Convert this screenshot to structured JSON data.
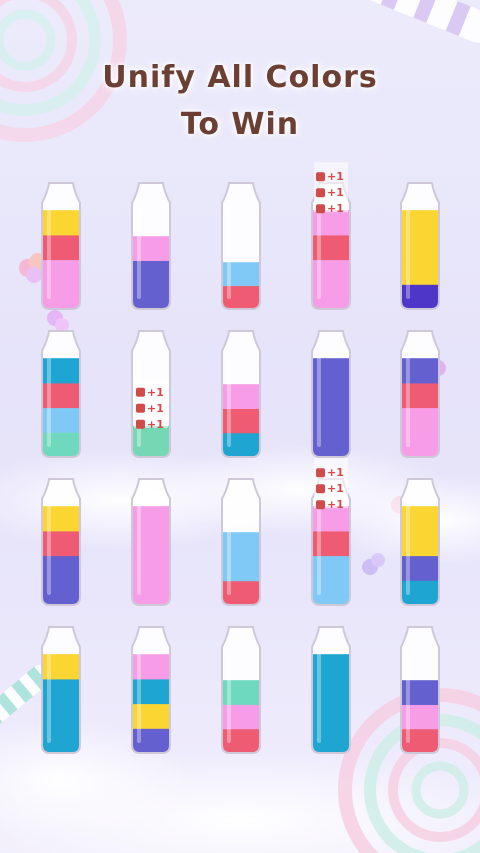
{
  "title": {
    "line1": "Unify All Colors",
    "line2": "To Win"
  },
  "colors": {
    "yellow": "#fbd532",
    "red": "#ef5b72",
    "pink": "#f79de7",
    "indigo": "#6460cf",
    "lightblue": "#80c9f6",
    "teal": "#6ed9bc",
    "darkblue": "#1fa5d2",
    "mint": "#75d7b4",
    "violet": "#4e36c8",
    "title": "#6b3f34",
    "bottle_outline": "#cfc8d8",
    "bonus_text": "#d24b4b"
  },
  "bottles": [
    {
      "fill": 0.95,
      "layers": [
        "pink",
        "pink",
        "red",
        "yellow"
      ]
    },
    {
      "fill": 0.7,
      "layers": [
        "indigo",
        "indigo",
        "pink"
      ]
    },
    {
      "fill": 0.45,
      "layers": [
        "red",
        "lightblue"
      ]
    },
    {
      "fill": 0.95,
      "layers": [
        "pink",
        "pink",
        "red",
        "pink"
      ],
      "bonus": [
        "+1",
        "+1",
        "+1"
      ]
    },
    {
      "fill": 0.95,
      "layers": [
        "violet",
        "yellow",
        "yellow",
        "yellow"
      ]
    },
    {
      "fill": 0.95,
      "layers": [
        "teal",
        "lightblue",
        "red",
        "darkblue"
      ]
    },
    {
      "fill": 0.3,
      "layers": [
        "mint"
      ],
      "bonus": [
        "+1",
        "+1",
        "+1"
      ]
    },
    {
      "fill": 0.7,
      "layers": [
        "darkblue",
        "red",
        "pink"
      ]
    },
    {
      "fill": 0.95,
      "layers": [
        "indigo",
        "indigo",
        "indigo",
        "indigo"
      ]
    },
    {
      "fill": 0.95,
      "layers": [
        "pink",
        "pink",
        "red",
        "indigo"
      ]
    },
    {
      "fill": 0.95,
      "layers": [
        "indigo",
        "indigo",
        "red",
        "yellow"
      ]
    },
    {
      "fill": 0.95,
      "layers": [
        "pink",
        "pink",
        "pink",
        "pink"
      ]
    },
    {
      "fill": 0.7,
      "layers": [
        "red",
        "lightblue",
        "lightblue"
      ]
    },
    {
      "fill": 0.95,
      "layers": [
        "lightblue",
        "lightblue",
        "red",
        "pink"
      ],
      "bonus": [
        "+1",
        "+1",
        "+1"
      ]
    },
    {
      "fill": 0.95,
      "layers": [
        "darkblue",
        "indigo",
        "yellow",
        "yellow"
      ]
    },
    {
      "fill": 0.95,
      "layers": [
        "darkblue",
        "darkblue",
        "darkblue",
        "yellow"
      ]
    },
    {
      "fill": 0.95,
      "layers": [
        "indigo",
        "yellow",
        "darkblue",
        "pink"
      ]
    },
    {
      "fill": 0.7,
      "layers": [
        "red",
        "pink",
        "teal"
      ]
    },
    {
      "fill": 0.95,
      "layers": [
        "darkblue",
        "darkblue",
        "darkblue",
        "darkblue"
      ]
    },
    {
      "fill": 0.7,
      "layers": [
        "red",
        "pink",
        "indigo"
      ]
    }
  ]
}
